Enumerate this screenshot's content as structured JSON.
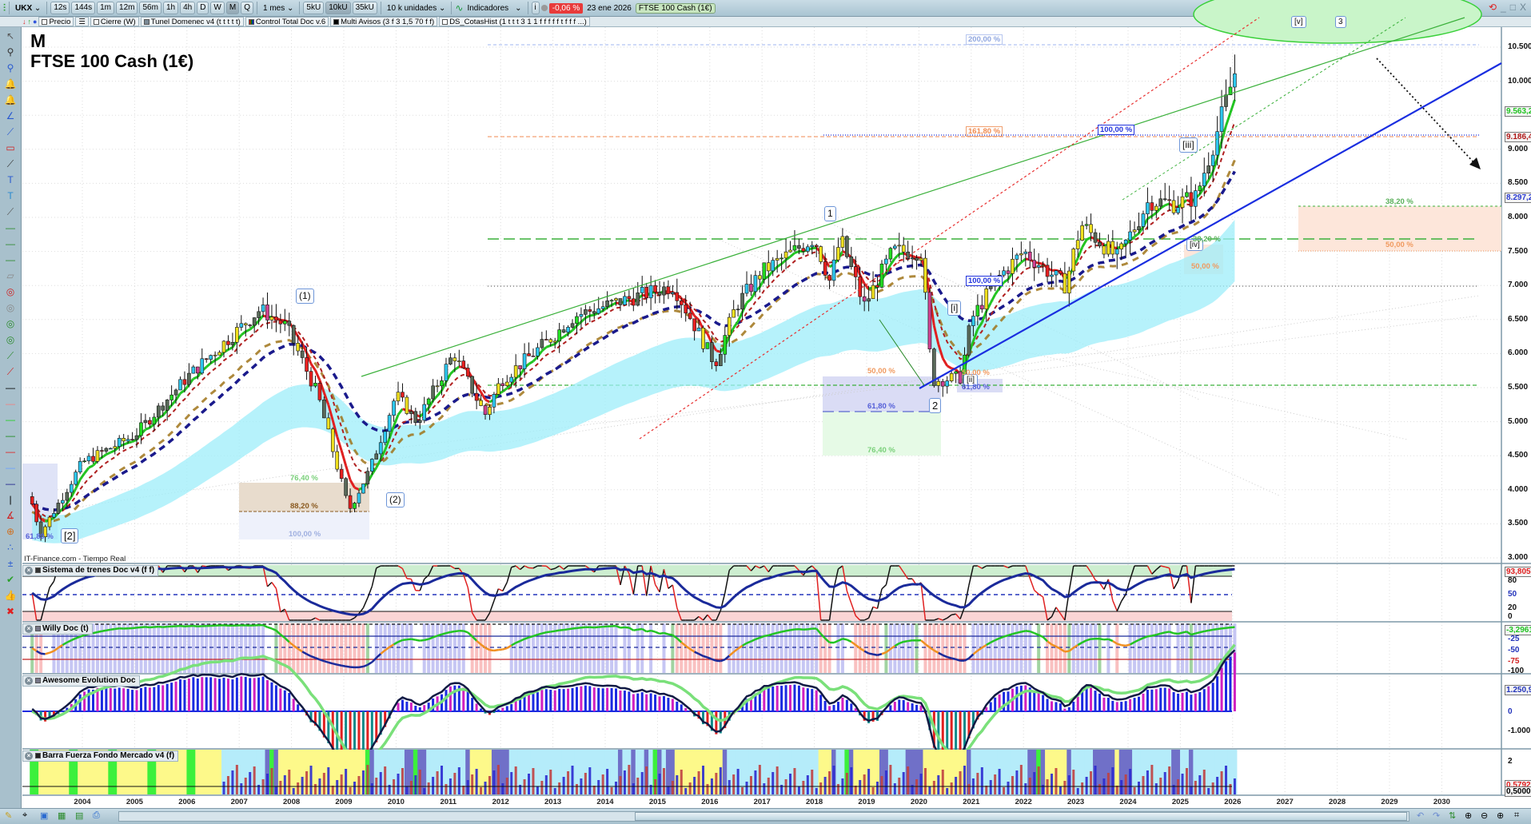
{
  "toolbar": {
    "symbol": "UKX",
    "intervals": [
      "12s",
      "144s",
      "1m",
      "12m",
      "56m",
      "1h",
      "4h",
      "D",
      "W",
      "M",
      "Q"
    ],
    "active_interval": "M",
    "period": "1 mes",
    "units": [
      "5kU",
      "10kU",
      "35kU"
    ],
    "active_unit": "10kU",
    "units_select": "10 k unidades",
    "indicators_label": "Indicadores",
    "info": "i",
    "change": "-0,06 %",
    "date": "23 ene 2026",
    "instrument": "FTSE 100 Cash (1€)",
    "window_controls": [
      "_",
      "□",
      "X"
    ]
  },
  "legend": {
    "items": [
      "Precio",
      "Cierre (W)",
      "Tunel Domenec v4 (t t t t t)",
      "Control Total Doc v.6",
      "Multi Avisos (3 f 3 1,5 70 f f)",
      "DS_CotasHist (1 t t t 3 1 1 f f f f f t f f f ...)"
    ]
  },
  "chart": {
    "period_label": "M",
    "title": "FTSE 100 Cash (1€)",
    "source": "IT-Finance.com - Tiempo Real",
    "price_ticks": [
      "10.500",
      "10.000",
      "9.500",
      "9.000",
      "8.500",
      "8.000",
      "7.500",
      "7.000",
      "6.500",
      "6.000",
      "5.500",
      "5.000",
      "4.500",
      "4.000",
      "3.500",
      "3.000"
    ],
    "price_tags": [
      {
        "text": "9.563,2",
        "color": "#22c422"
      },
      {
        "text": "9.186,4",
        "color": "#b01818"
      },
      {
        "text": "8.297,2",
        "color": "#2a3ad0"
      }
    ],
    "years": [
      "2004",
      "2005",
      "2006",
      "2007",
      "2008",
      "2009",
      "2010",
      "2011",
      "2012",
      "2013",
      "2014",
      "2015",
      "2016",
      "2017",
      "2018",
      "2019",
      "2020",
      "2021",
      "2022",
      "2023",
      "2024",
      "2025",
      "2026",
      "2027",
      "2028",
      "2029",
      "2030"
    ],
    "waves": [
      "(1)",
      "(2)",
      "[2]",
      "1",
      "2",
      "[i]",
      "[ii]",
      "[iii]",
      "[iv]",
      "[v]",
      "3"
    ],
    "fibs": [
      "200,00 %",
      "161,80 %",
      "100,00 %",
      "100,00 %",
      "61,80 %",
      "76,40 %",
      "88,20 %",
      "100,00 %",
      "50,00 %",
      "61,80 %",
      "76,40 %",
      "50,00 %",
      "61,80 %",
      "38,20 %",
      "50,00 %",
      "38,20 %",
      "50,00 %"
    ]
  },
  "chart_data": {
    "type": "candlestick",
    "timeframe": "monthly",
    "ylim": [
      3000,
      10500
    ],
    "xlim": [
      2003,
      2030.5
    ],
    "price_anchors": [
      [
        2003.0,
        3900
      ],
      [
        2003.2,
        3350
      ],
      [
        2004.0,
        4400
      ],
      [
        2005.0,
        4800
      ],
      [
        2006.0,
        5650
      ],
      [
        2007.4,
        6650
      ],
      [
        2007.9,
        6400
      ],
      [
        2008.5,
        5400
      ],
      [
        2009.1,
        3700
      ],
      [
        2009.5,
        4300
      ],
      [
        2010.0,
        5400
      ],
      [
        2010.4,
        5000
      ],
      [
        2011.1,
        6000
      ],
      [
        2011.7,
        5100
      ],
      [
        2012.0,
        5600
      ],
      [
        2013.0,
        6250
      ],
      [
        2013.4,
        6550
      ],
      [
        2014.0,
        6700
      ],
      [
        2015.3,
        7000
      ],
      [
        2016.1,
        5850
      ],
      [
        2016.5,
        6700
      ],
      [
        2017.0,
        7200
      ],
      [
        2018.0,
        7700
      ],
      [
        2018.3,
        7050
      ],
      [
        2018.5,
        7700
      ],
      [
        2018.95,
        6700
      ],
      [
        2019.5,
        7500
      ],
      [
        2020.05,
        7500
      ],
      [
        2020.25,
        5600
      ],
      [
        2020.8,
        5650
      ],
      [
        2021.0,
        6500
      ],
      [
        2021.5,
        7100
      ],
      [
        2022.0,
        7500
      ],
      [
        2022.8,
        7000
      ],
      [
        2023.1,
        7900
      ],
      [
        2023.8,
        7400
      ],
      [
        2024.4,
        8250
      ],
      [
        2024.9,
        8200
      ],
      [
        2025.3,
        8300
      ],
      [
        2025.7,
        9250
      ],
      [
        2026.05,
        10150
      ]
    ]
  },
  "panels": {
    "sistema": {
      "title": "Sistema de trenes Doc v4 (f f)",
      "ticks": [
        "80",
        "50",
        "20",
        "0"
      ],
      "value": "93,805"
    },
    "willy": {
      "title": "Willy Doc (t)",
      "ticks": [
        "-25",
        "-50",
        "-75",
        "-100"
      ],
      "value": "-3,2961"
    },
    "awesome": {
      "title": "Awesome Evolution Doc",
      "ticks": [
        "0",
        "-1.000"
      ],
      "value": "1.250,9"
    },
    "barra": {
      "title": "Barra Fuerza Fondo Mercado v4 (f)",
      "ticks": [
        "2"
      ],
      "value": "0,5792",
      "value2": "0,5000"
    }
  },
  "colors": {
    "up": "#2ec8f0",
    "down": "#e82020",
    "ema_fast": "#22c422",
    "ema_slow": "#1a1a8c",
    "band": "#9eeefa",
    "trend": "#1a2ee0"
  }
}
